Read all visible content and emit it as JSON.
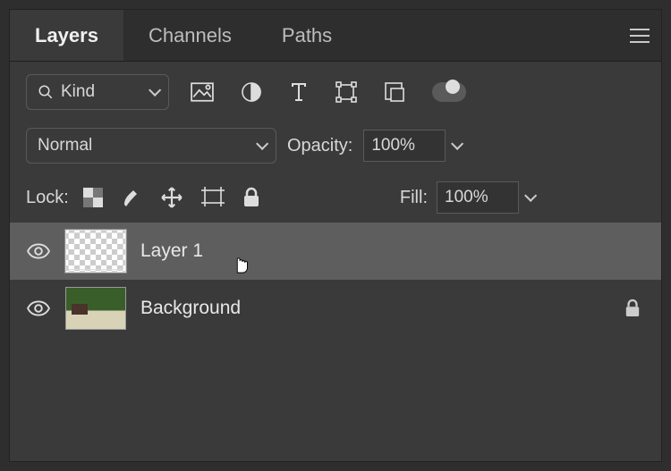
{
  "tabs": {
    "layers": "Layers",
    "channels": "Channels",
    "paths": "Paths"
  },
  "filter": {
    "kind": "Kind"
  },
  "blend": {
    "mode": "Normal",
    "opacity_label": "Opacity:",
    "opacity_value": "100%"
  },
  "lock": {
    "label": "Lock:",
    "fill_label": "Fill:",
    "fill_value": "100%"
  },
  "layers": [
    {
      "name": "Layer 1",
      "selected": true,
      "locked": false,
      "thumb": "empty"
    },
    {
      "name": "Background",
      "selected": false,
      "locked": true,
      "thumb": "photo"
    }
  ]
}
